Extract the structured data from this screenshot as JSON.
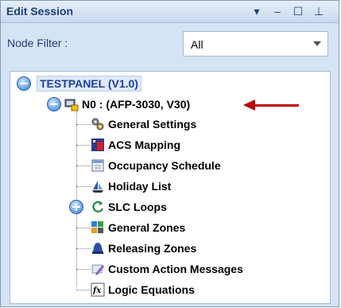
{
  "panel": {
    "title": "Edit Session",
    "icons": [
      "dropdown-icon",
      "minimize-icon",
      "maximize-icon",
      "pin-icon"
    ],
    "accent_color": "#1f3f76"
  },
  "filter": {
    "label": "Node Filter :",
    "selected": "All"
  },
  "tree": {
    "root": "TESTPANEL (V1.0)",
    "node": "N0 : (AFP-3030, V30)",
    "children": [
      {
        "label": "General Settings",
        "icon": "gears-icon"
      },
      {
        "label": "ACS Mapping",
        "icon": "acs-mapping-icon"
      },
      {
        "label": "Occupancy Schedule",
        "icon": "calendar-icon"
      },
      {
        "label": "Holiday List",
        "icon": "sailboat-icon"
      },
      {
        "label": "SLC Loops",
        "icon": "loop-refresh-icon"
      },
      {
        "label": "General Zones",
        "icon": "zones-grid-icon"
      },
      {
        "label": "Releasing Zones",
        "icon": "bell-icon"
      },
      {
        "label": "Custom Action Messages",
        "icon": "pencil-icon"
      },
      {
        "label": "Logic Equations",
        "icon": "fx-icon"
      }
    ]
  },
  "annotation": {
    "color": "#c00000"
  }
}
